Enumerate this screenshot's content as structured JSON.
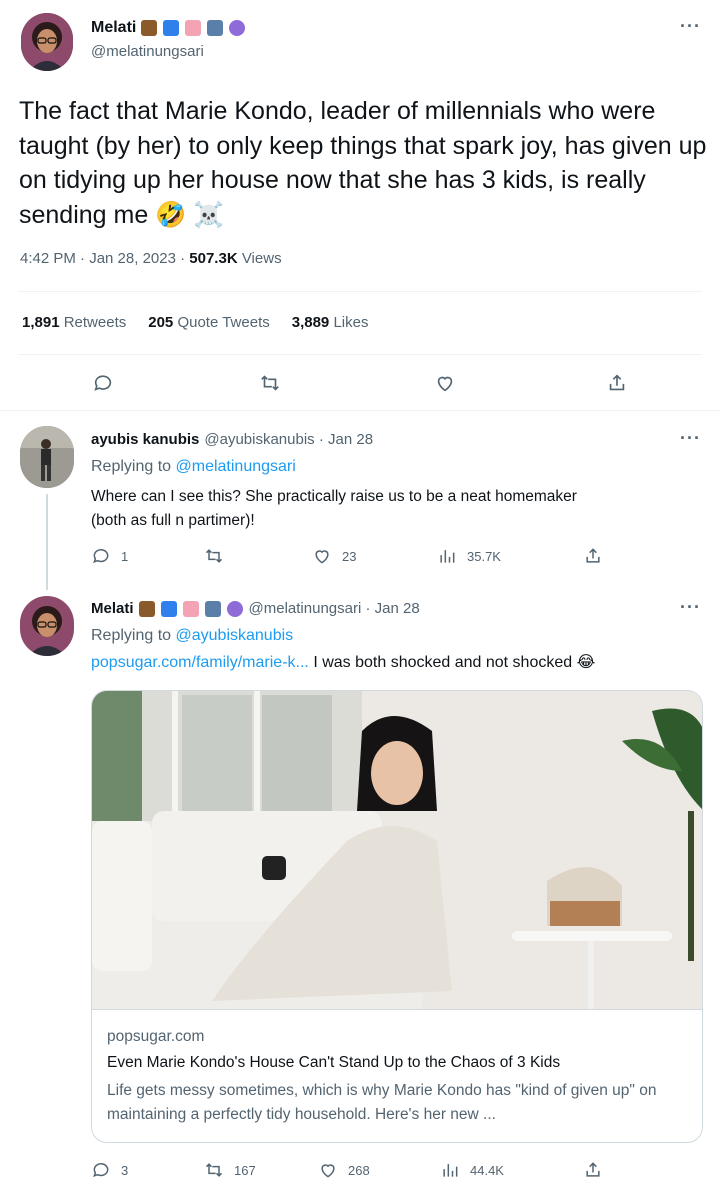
{
  "main_tweet": {
    "author_name": "Melati",
    "author_handle": "@melatinungsari",
    "emoji_icons": [
      "woman-teacher-emoji-icon",
      "wave-emoji-icon",
      "hibiscus-emoji-icon",
      "bar-chart-emoji-icon",
      "crystal-ball-emoji-icon"
    ],
    "text": "The fact that Marie Kondo, leader of millennials who were taught (by her) to only keep things that spark joy, has given up on tidying up her house now that she has 3 kids, is really sending me",
    "trailing_emoji": "🤣 ☠️",
    "time": "4:42 PM · Jan 28, 2023 ·",
    "views_count": "507.3K",
    "views_label": "Views",
    "stats": {
      "retweets_count": "1,891",
      "retweets_label": "Retweets",
      "quotes_count": "205",
      "quotes_label": "Quote Tweets",
      "likes_count": "3,889",
      "likes_label": "Likes"
    },
    "more": "···"
  },
  "reply1": {
    "author_name": "ayubis kanubis",
    "handle_date": "@ayubiskanubis · Jan 28",
    "replying_prefix": "Replying to",
    "replying_to": "@melatinungsari",
    "text_line1": "Where can I see this? She practically raise us to be a neat homemaker",
    "text_line2": "(both as full n partimer)!",
    "replies": "1",
    "retweets": "",
    "likes": "23",
    "views": "35.7K",
    "more": "···"
  },
  "reply2": {
    "author_name": "Melati",
    "handle_date": "@melatinungsari · Jan 28",
    "replying_prefix": "Replying to",
    "replying_to": "@ayubiskanubis",
    "link_text": "popsugar.com/family/marie-k...",
    "text": "I was both shocked and not shocked",
    "trailing_emoji": "😂",
    "card": {
      "domain": "popsugar.com",
      "title": "Even Marie Kondo's House Can't Stand Up to the Chaos of 3 Kids",
      "description": "Life gets messy sometimes, which is why Marie Kondo has \"kind of given up\" on maintaining a perfectly tidy household. Here's her new ..."
    },
    "replies": "3",
    "retweets": "167",
    "likes": "268",
    "views": "44.4K",
    "more": "···"
  },
  "colors": {
    "accent": "#1d9bf0",
    "muted": "#536471",
    "border": "#eff3f4"
  }
}
